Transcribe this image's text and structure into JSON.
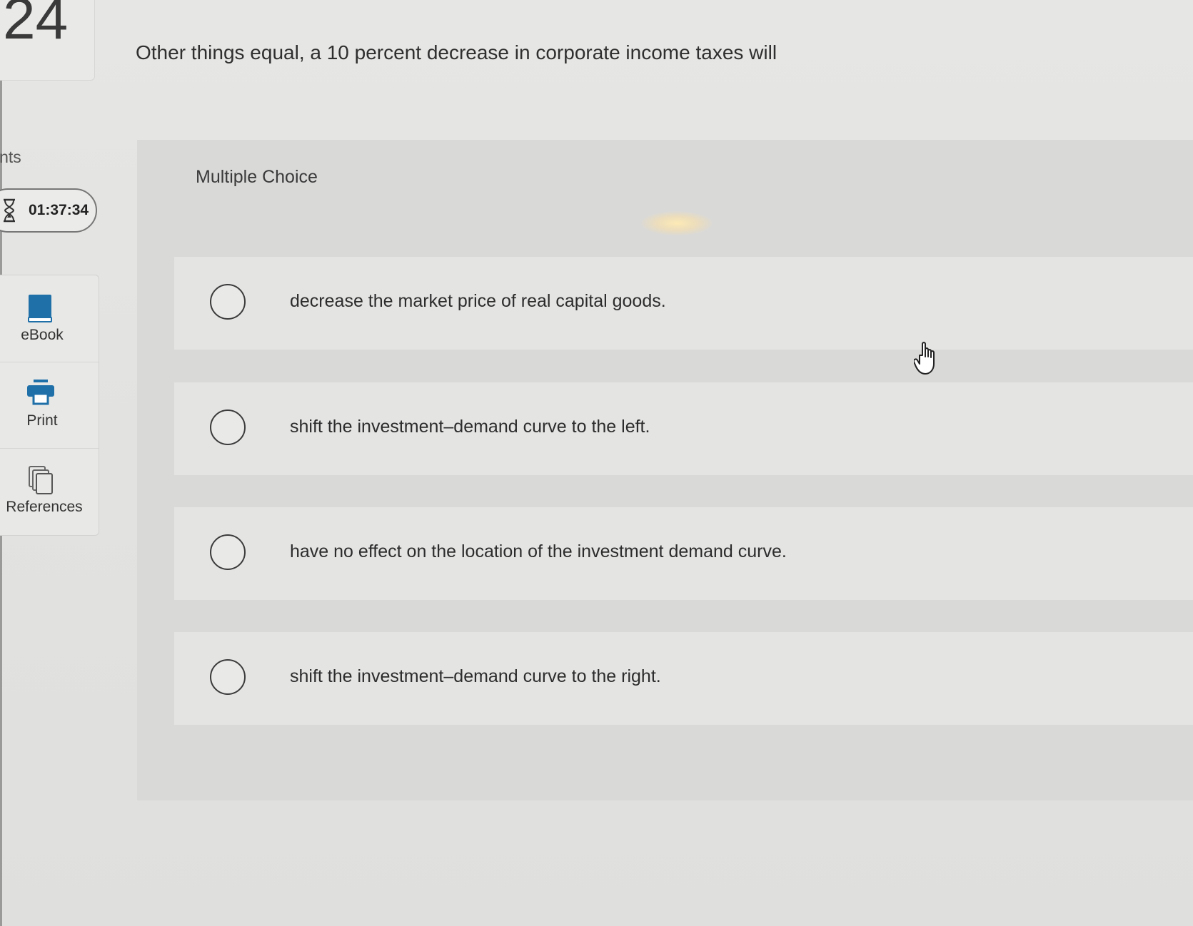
{
  "question": {
    "number": "24",
    "points_label": "ints",
    "stem": "Other things equal, a 10 percent decrease in corporate income taxes will"
  },
  "timer": {
    "value": "01:37:34",
    "icon": "hourglass-icon"
  },
  "tools": [
    {
      "label": "eBook",
      "icon": "book-icon"
    },
    {
      "label": "Print",
      "icon": "printer-icon"
    },
    {
      "label": "References",
      "icon": "copy-pages-icon"
    }
  ],
  "mc": {
    "type_label": "Multiple Choice",
    "options": [
      {
        "text": "decrease the market price of real capital goods."
      },
      {
        "text": "shift the investment–demand curve to the left."
      },
      {
        "text": "have no effect on the location of the investment demand curve."
      },
      {
        "text": "shift the investment–demand curve to the right."
      }
    ]
  },
  "colors": {
    "book_icon": "#1f6fa8",
    "printer_icon": "#1f6fa8",
    "panel_bg": "#d9d9d8"
  }
}
